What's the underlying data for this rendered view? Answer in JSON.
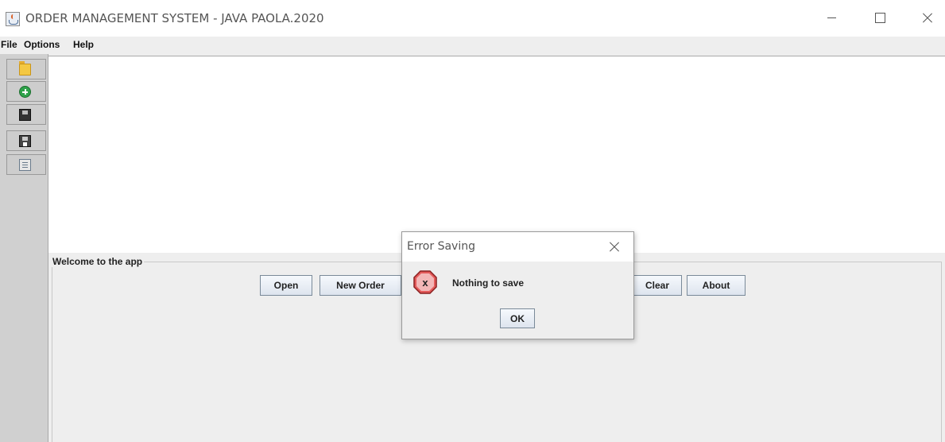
{
  "window": {
    "title": "ORDER MANAGEMENT SYSTEM - JAVA PAOLA.2020"
  },
  "menu": {
    "file": "File",
    "options": "Options",
    "help": "Help"
  },
  "toolbar": {
    "icons": [
      "open-folder-icon",
      "add-order-icon",
      "save-icon",
      "save-as-icon",
      "document-icon"
    ]
  },
  "panel": {
    "title": "Welcome to the app",
    "buttons": {
      "open": "Open",
      "new_order": "New Order",
      "clear": "Clear",
      "about": "About"
    }
  },
  "dialog": {
    "title": "Error Saving",
    "icon_letter": "x",
    "message": "Nothing to save",
    "ok_label": "OK"
  },
  "colors": {
    "error_red": "#d9534f",
    "toolbar_gray": "#d0d0d0"
  }
}
